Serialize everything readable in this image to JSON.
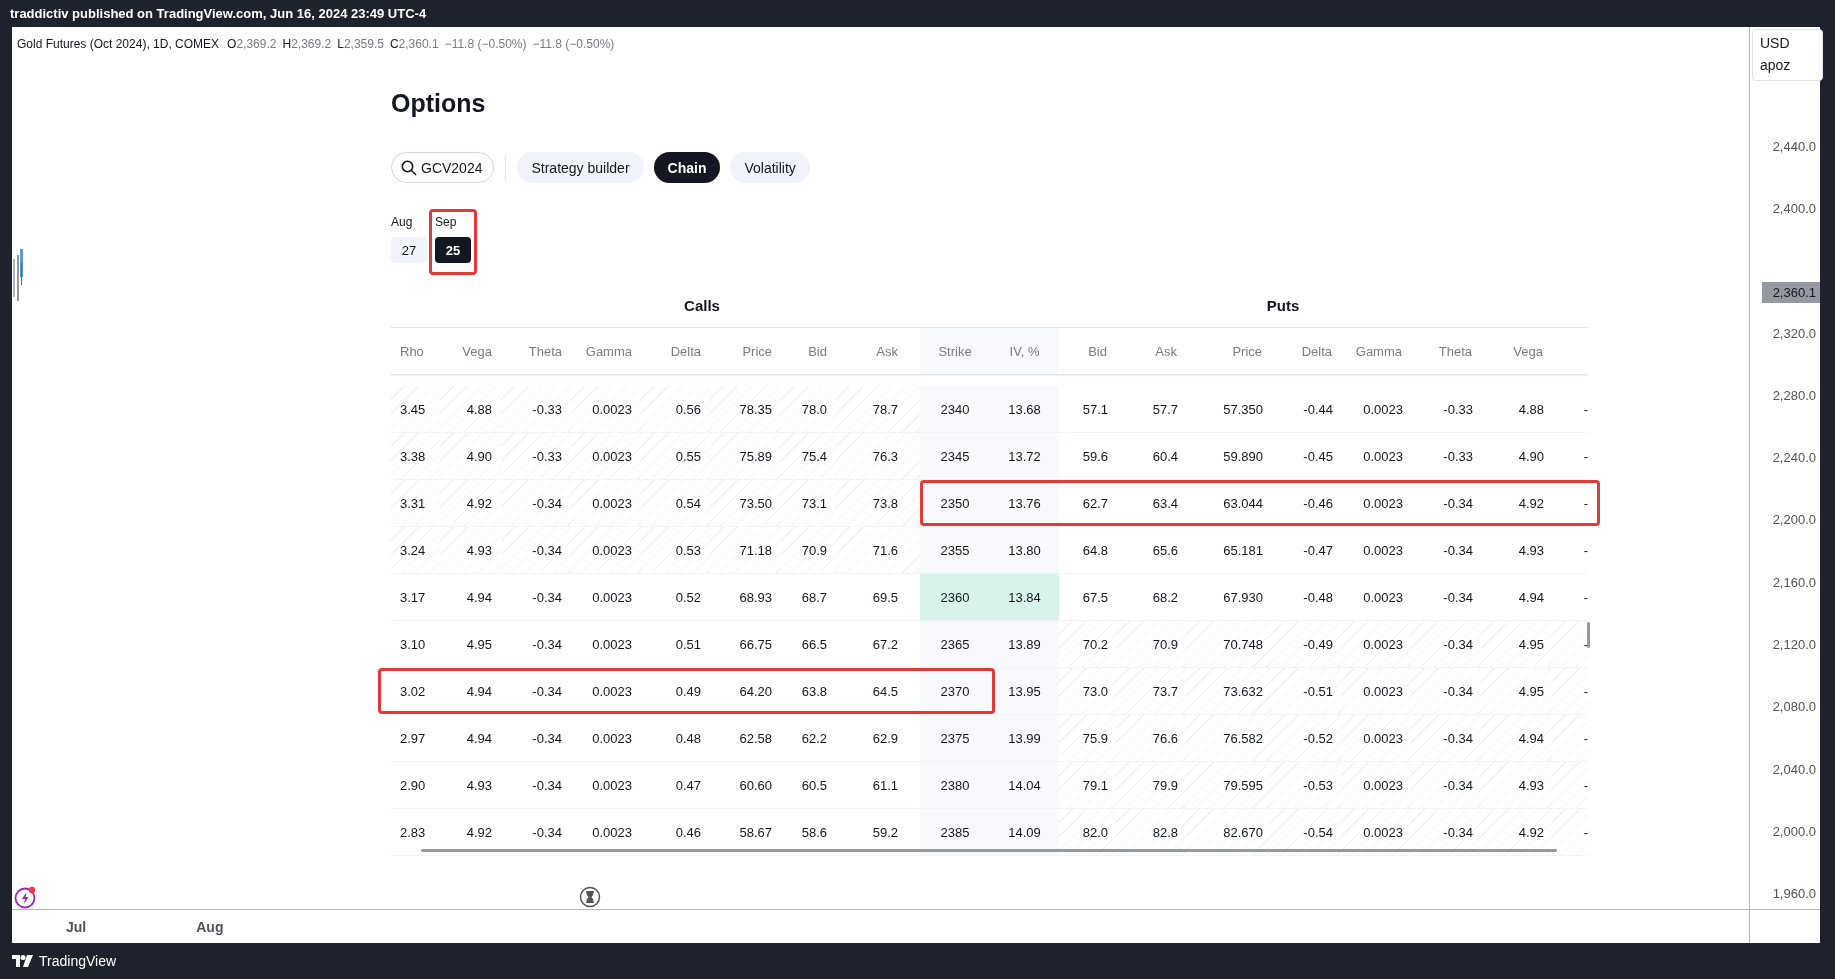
{
  "top_bar": {
    "text": "traddictiv published on TradingView.com, Jun 16, 2024 23:49 UTC-4"
  },
  "legend": {
    "symbol": "Gold Futures (Oct 2024), 1D, COMEX",
    "ohlc": [
      {
        "label": "O",
        "value": "2,369.2"
      },
      {
        "label": "H",
        "value": "2,369.2"
      },
      {
        "label": "L",
        "value": "2,359.5"
      },
      {
        "label": "C",
        "value": "2,360.1"
      }
    ],
    "changes": [
      "−11.8 (−0.50%)",
      "−11.8 (−0.50%)"
    ]
  },
  "options": {
    "title": "Options",
    "search": {
      "value": "GCV2024"
    },
    "tabs": [
      {
        "label": "Strategy builder",
        "selected": false
      },
      {
        "label": "Chain",
        "selected": true
      },
      {
        "label": "Volatility",
        "selected": false
      }
    ],
    "expirations": [
      {
        "month": "Aug",
        "day": "27",
        "selected": false,
        "boxed": false
      },
      {
        "month": "Sep",
        "day": "25",
        "selected": true,
        "boxed": true
      }
    ],
    "groups": [
      "Calls",
      "Puts"
    ],
    "columns": [
      {
        "label": "Rho",
        "kind": "call"
      },
      {
        "label": "Vega",
        "kind": "call"
      },
      {
        "label": "Theta",
        "kind": "call"
      },
      {
        "label": "Gamma",
        "kind": "call"
      },
      {
        "label": "Delta",
        "kind": "call"
      },
      {
        "label": "Price",
        "kind": "call"
      },
      {
        "label": "Bid",
        "kind": "call"
      },
      {
        "label": "Ask",
        "kind": "call"
      },
      {
        "label": "Strike",
        "kind": "strike"
      },
      {
        "label": "IV, %",
        "kind": "strike"
      },
      {
        "label": "Bid",
        "kind": "put"
      },
      {
        "label": "Ask",
        "kind": "put"
      },
      {
        "label": "Price",
        "kind": "put"
      },
      {
        "label": "Delta",
        "kind": "put"
      },
      {
        "label": "Gamma",
        "kind": "put"
      },
      {
        "label": "Theta",
        "kind": "put"
      },
      {
        "label": "Vega",
        "kind": "put"
      }
    ],
    "rows": [
      {
        "cells": [
          "3.45",
          "4.88",
          "-0.33",
          "0.0023",
          "0.56",
          "78.35",
          "78.0",
          "78.7",
          "2340",
          "13.68",
          "57.1",
          "57.7",
          "57.350",
          "-0.44",
          "0.0023",
          "-0.33",
          "4.88",
          "-"
        ],
        "calls_itm": true,
        "puts_itm": false,
        "atm": false,
        "calls_boxed": false,
        "puts_boxed": false
      },
      {
        "cells": [
          "3.38",
          "4.90",
          "-0.33",
          "0.0023",
          "0.55",
          "75.89",
          "75.4",
          "76.3",
          "2345",
          "13.72",
          "59.6",
          "60.4",
          "59.890",
          "-0.45",
          "0.0023",
          "-0.33",
          "4.90",
          "-"
        ],
        "calls_itm": true,
        "puts_itm": false,
        "atm": false,
        "calls_boxed": false,
        "puts_boxed": false
      },
      {
        "cells": [
          "3.31",
          "4.92",
          "-0.34",
          "0.0023",
          "0.54",
          "73.50",
          "73.1",
          "73.8",
          "2350",
          "13.76",
          "62.7",
          "63.4",
          "63.044",
          "-0.46",
          "0.0023",
          "-0.34",
          "4.92",
          "-"
        ],
        "calls_itm": true,
        "puts_itm": false,
        "atm": false,
        "calls_boxed": false,
        "puts_boxed": true
      },
      {
        "cells": [
          "3.24",
          "4.93",
          "-0.34",
          "0.0023",
          "0.53",
          "71.18",
          "70.9",
          "71.6",
          "2355",
          "13.80",
          "64.8",
          "65.6",
          "65.181",
          "-0.47",
          "0.0023",
          "-0.34",
          "4.93",
          "-"
        ],
        "calls_itm": true,
        "puts_itm": false,
        "atm": false,
        "calls_boxed": false,
        "puts_boxed": false
      },
      {
        "cells": [
          "3.17",
          "4.94",
          "-0.34",
          "0.0023",
          "0.52",
          "68.93",
          "68.7",
          "69.5",
          "2360",
          "13.84",
          "67.5",
          "68.2",
          "67.930",
          "-0.48",
          "0.0023",
          "-0.34",
          "4.94",
          "-"
        ],
        "calls_itm": false,
        "puts_itm": false,
        "atm": true,
        "calls_boxed": false,
        "puts_boxed": false
      },
      {
        "cells": [
          "3.10",
          "4.95",
          "-0.34",
          "0.0023",
          "0.51",
          "66.75",
          "66.5",
          "67.2",
          "2365",
          "13.89",
          "70.2",
          "70.9",
          "70.748",
          "-0.49",
          "0.0023",
          "-0.34",
          "4.95",
          "-"
        ],
        "calls_itm": false,
        "puts_itm": true,
        "atm": false,
        "calls_boxed": false,
        "puts_boxed": false
      },
      {
        "cells": [
          "3.02",
          "4.94",
          "-0.34",
          "0.0023",
          "0.49",
          "64.20",
          "63.8",
          "64.5",
          "2370",
          "13.95",
          "73.0",
          "73.7",
          "73.632",
          "-0.51",
          "0.0023",
          "-0.34",
          "4.95",
          "-"
        ],
        "calls_itm": false,
        "puts_itm": true,
        "atm": false,
        "calls_boxed": true,
        "puts_boxed": false
      },
      {
        "cells": [
          "2.97",
          "4.94",
          "-0.34",
          "0.0023",
          "0.48",
          "62.58",
          "62.2",
          "62.9",
          "2375",
          "13.99",
          "75.9",
          "76.6",
          "76.582",
          "-0.52",
          "0.0023",
          "-0.34",
          "4.94",
          "-"
        ],
        "calls_itm": false,
        "puts_itm": true,
        "atm": false,
        "calls_boxed": false,
        "puts_boxed": false
      },
      {
        "cells": [
          "2.90",
          "4.93",
          "-0.34",
          "0.0023",
          "0.47",
          "60.60",
          "60.5",
          "61.1",
          "2380",
          "14.04",
          "79.1",
          "79.9",
          "79.595",
          "-0.53",
          "0.0023",
          "-0.34",
          "4.93",
          "-"
        ],
        "calls_itm": false,
        "puts_itm": true,
        "atm": false,
        "calls_boxed": false,
        "puts_boxed": false
      },
      {
        "cells": [
          "2.83",
          "4.92",
          "-0.34",
          "0.0023",
          "0.46",
          "58.67",
          "58.6",
          "59.2",
          "2385",
          "14.09",
          "82.0",
          "82.8",
          "82.670",
          "-0.54",
          "0.0023",
          "-0.34",
          "4.92",
          "-"
        ],
        "calls_itm": false,
        "puts_itm": true,
        "atm": false,
        "calls_boxed": false,
        "puts_boxed": false
      }
    ]
  },
  "price_axis": {
    "currency": "USD",
    "unit": "apoz",
    "ticks": [
      {
        "kind": "tick",
        "label": "2,440.0"
      },
      {
        "kind": "tick",
        "label": "2,400.0"
      },
      {
        "kind": "current",
        "label": "2,360.1"
      },
      {
        "kind": "tick",
        "label": "2,320.0"
      },
      {
        "kind": "tick",
        "label": "2,280.0"
      },
      {
        "kind": "tick",
        "label": "2,240.0"
      },
      {
        "kind": "tick",
        "label": "2,200.0"
      },
      {
        "kind": "tick",
        "label": "2,160.0"
      },
      {
        "kind": "tick",
        "label": "2,120.0"
      },
      {
        "kind": "tick",
        "label": "2,080.0"
      },
      {
        "kind": "tick",
        "label": "2,040.0"
      },
      {
        "kind": "tick",
        "label": "2,000.0"
      },
      {
        "kind": "tick",
        "label": "1,960.0"
      }
    ]
  },
  "time_axis": {
    "labels": [
      "Jul",
      "Aug"
    ]
  },
  "footer": {
    "brand": "TradingView"
  }
}
